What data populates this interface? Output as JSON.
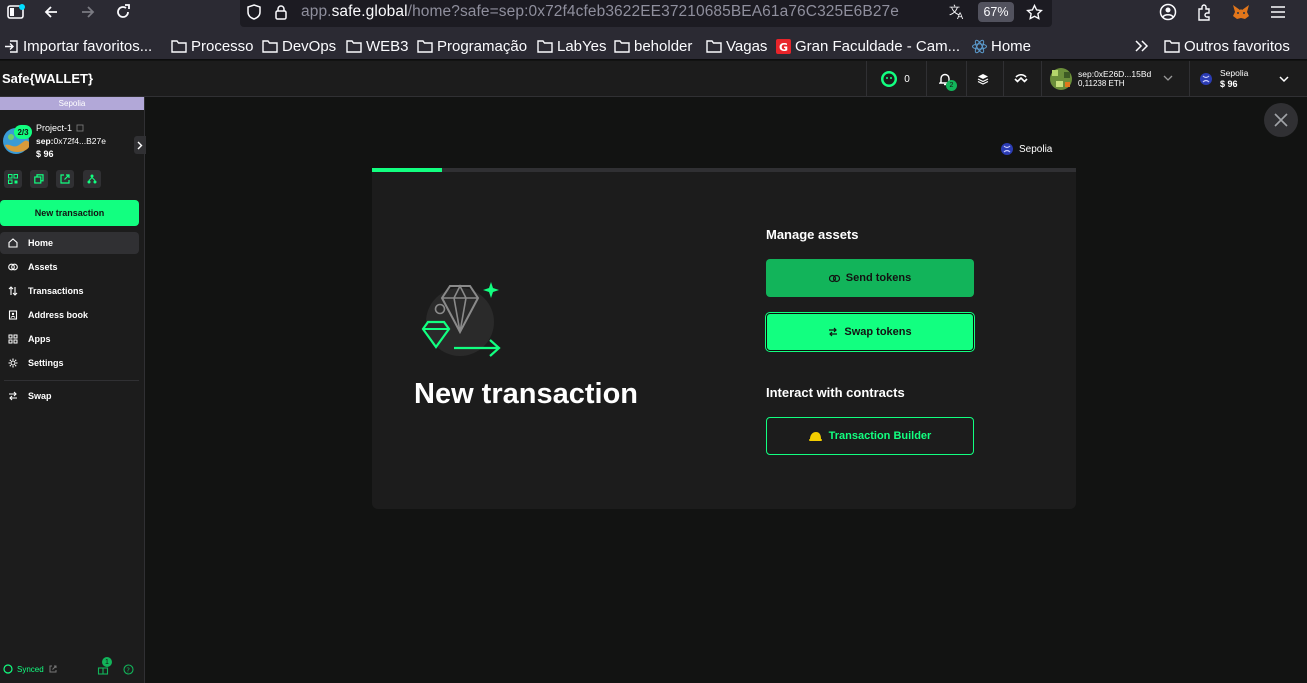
{
  "browser": {
    "url_prefix": "app.",
    "url_domain": "safe.global",
    "url_path": "/home?safe=sep:0x72f4cfeb3622EE37210685BEA61a76C325E6B27e",
    "zoom": "67%"
  },
  "bookmarks": [
    {
      "label": "Importar favoritos..."
    },
    {
      "label": "Processo"
    },
    {
      "label": "DevOps"
    },
    {
      "label": "WEB3"
    },
    {
      "label": "Programação"
    },
    {
      "label": "LabYes"
    },
    {
      "label": "beholder"
    },
    {
      "label": "Vagas"
    },
    {
      "label": "Gran Faculdade - Cam..."
    },
    {
      "label": "Home"
    },
    {
      "label": "Outros favoritos"
    }
  ],
  "header": {
    "brand": "Safe{WALLET}",
    "pending_count": "0",
    "notification_count": "2",
    "account_address": "sep:0xE26D...15Bd",
    "account_balance": "0,11238 ETH",
    "network_name": "Sepolia",
    "network_balance": "$ 96"
  },
  "sidebar": {
    "network": "Sepolia",
    "threshold": "2/3",
    "safe_name": "Project-1",
    "safe_address_prefix": "sep:",
    "safe_address": "0x72f4...B27e",
    "safe_balance": "$ 96",
    "new_tx_label": "New transaction",
    "nav": [
      {
        "label": "Home",
        "icon": "home-icon"
      },
      {
        "label": "Assets",
        "icon": "assets-icon"
      },
      {
        "label": "Transactions",
        "icon": "transactions-icon"
      },
      {
        "label": "Address book",
        "icon": "address-book-icon"
      },
      {
        "label": "Apps",
        "icon": "apps-icon"
      },
      {
        "label": "Settings",
        "icon": "settings-icon"
      },
      {
        "label": "Swap",
        "icon": "swap-icon"
      }
    ],
    "synced_label": "Synced",
    "badge_count": "1"
  },
  "modal": {
    "network": "Sepolia",
    "progress": 0.1,
    "title": "New transaction",
    "manage_assets_title": "Manage assets",
    "send_tokens_label": "Send tokens",
    "swap_tokens_label": "Swap tokens",
    "interact_title": "Interact with contracts",
    "tx_builder_label": "Transaction Builder"
  },
  "colors": {
    "accent": "#12ff80",
    "send_button": "#12b45a",
    "background": "#121312",
    "card": "#1c1c1c"
  }
}
